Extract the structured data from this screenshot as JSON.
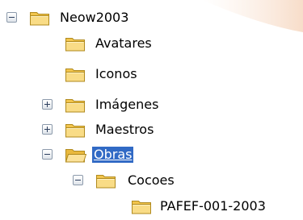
{
  "tree": {
    "nodes": [
      {
        "label": "Neow2003",
        "state": "expanded",
        "icon": "folder-closed-icon"
      },
      {
        "label": "Avatares",
        "state": "leaf",
        "icon": "folder-closed-icon"
      },
      {
        "label": "Iconos",
        "state": "leaf",
        "icon": "folder-closed-icon"
      },
      {
        "label": "Imágenes",
        "state": "collapsed",
        "icon": "folder-closed-icon"
      },
      {
        "label": "Maestros",
        "state": "collapsed",
        "icon": "folder-closed-icon"
      },
      {
        "label": "Obras",
        "state": "expanded",
        "selected": true,
        "icon": "folder-open-icon"
      },
      {
        "label": "Cocoes",
        "state": "expanded",
        "icon": "folder-closed-icon"
      },
      {
        "label": "PAFEF-001-2003",
        "state": "leaf",
        "icon": "folder-closed-icon"
      }
    ]
  },
  "colors": {
    "selection_bg": "#316ac5",
    "selection_text": "#ffffff",
    "folder_fill": "#f7d46e",
    "folder_outline": "#b08a1e"
  }
}
